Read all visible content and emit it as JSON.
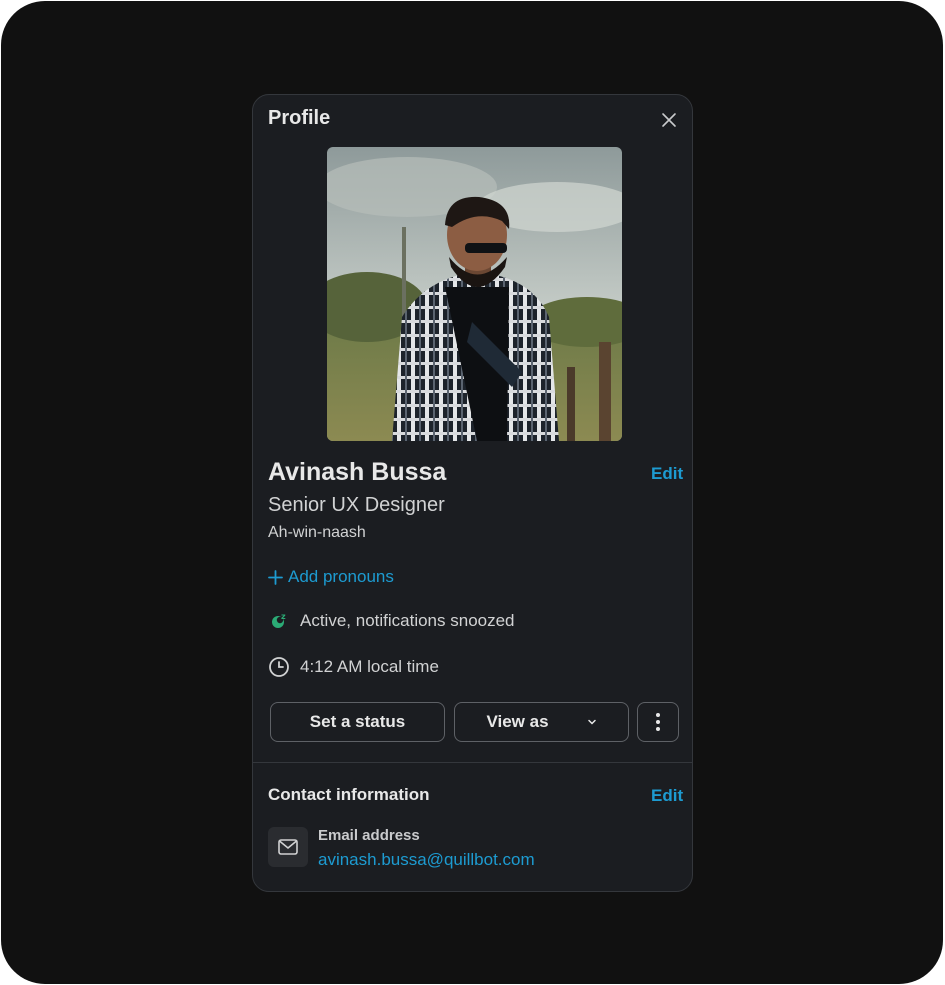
{
  "profile": {
    "title": "Profile",
    "name": "Avinash Bussa",
    "edit_label": "Edit",
    "role": "Senior UX Designer",
    "pronunciation": "Ah-win-naash",
    "add_pronouns": "Add pronouns",
    "status_text": "Active, notifications snoozed",
    "local_time": "4:12 AM local time"
  },
  "actions": {
    "set_status": "Set a status",
    "view_as": "View as"
  },
  "contact": {
    "title": "Contact information",
    "edit_label": "Edit",
    "email_label": "Email address",
    "email_value": "avinash.bussa@quillbot.com"
  },
  "colors": {
    "accent": "#1d9bd1",
    "status_active": "#2bac76",
    "panel_bg": "#1b1d21"
  },
  "icons": {
    "close": "close-icon",
    "add": "plus-icon",
    "status": "snooze-status-icon",
    "time": "clock-icon",
    "more": "more-vertical-icon",
    "view_as_caret": "chevron-down-icon",
    "email": "mail-icon"
  }
}
